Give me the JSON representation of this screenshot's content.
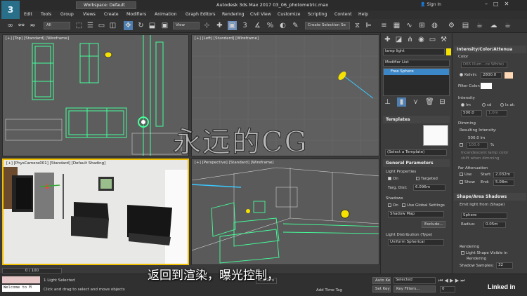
{
  "app": {
    "logo": "3",
    "title": "Autodesk 3ds Max 2017    03_06_photometric.max",
    "workspace": "Workspace: Default",
    "sign_in": "Sign In"
  },
  "menu": [
    "Edit",
    "Tools",
    "Group",
    "Views",
    "Create",
    "Modifiers",
    "Animation",
    "Graph Editors",
    "Rendering",
    "Civil View",
    "Customize",
    "Scripting",
    "Content",
    "Help"
  ],
  "toolbar": {
    "filter_dropdown": "All",
    "view_dropdown": "View",
    "selection_set": "Create Selection Se"
  },
  "viewports": {
    "top": "[+] [Top] [Standard] [Wireframe]",
    "left": "[+] [Left] [Standard] [Wireframe]",
    "camera": "[+] [PhysCamera001] [Standard] [Default Shading]",
    "perspective": "[+] [Perspective] [Standard] [Wireframe]"
  },
  "command_panel": {
    "object_name": "lamp light",
    "modifier_list": "Modifier List",
    "stack_item": "Free Sphere",
    "templates_header": "Templates",
    "templates_select": "(Select a Template)",
    "general_header": "General Parameters",
    "light_props": "Light Properties",
    "on": "On",
    "targeted": "Targeted",
    "targ_dist_label": "Targ. Dist:",
    "targ_dist": "6.096m",
    "shadows": "Shadows",
    "shadows_on": "On",
    "use_global": "Use Global Settings",
    "shadow_map": "Shadow Map",
    "exclude": "Exclude...",
    "light_dist_label": "Light Distribution (Type)",
    "light_dist": "Uniform Spherical"
  },
  "rollout": {
    "intensity_header": "Intensity/Color/Attenua",
    "color_label": "Color",
    "color_preset": "D65 Illum...ce White)",
    "kelvin_label": "Kelvin:",
    "kelvin": "2800.0",
    "filter_color": "Filter Color:",
    "intensity_label": "Intensity",
    "lm": "lm",
    "cd": "cd",
    "lx_at": "lx at:",
    "intensity_value": "500.0",
    "lx_dist": "1.0m",
    "dimming_label": "Dimming",
    "resulting": "Resulting Intensity:",
    "resulting_value": "500.0 lm",
    "dim_percent": "100.0",
    "percent_sign": "%",
    "incandescent": "Incandescent lamp color",
    "shift_dimming": "shift when dimming",
    "far_atten": "Far Attenuation",
    "use": "Use",
    "start_label": "Start:",
    "start": "2.032m",
    "show": "Show",
    "end_label": "End:",
    "end": "5.08m",
    "shape_header": "Shape/Area Shadows",
    "emit_label": "Emit light from (Shape)",
    "emit_shape": "Sphere",
    "radius_label": "Radius:",
    "radius": "0.05m",
    "rendering_label": "Rendering",
    "light_shape_1": "Light Shape Visible in",
    "light_shape_2": "Rendering",
    "shadow_samples_label": "Shadow Samples:",
    "shadow_samples": "32"
  },
  "status": {
    "frame_counter": "0 / 100",
    "script_listener": "Welcome to M",
    "selected": "1 Light Selected",
    "prompt": "Click and drag to select and move objects",
    "coord": "-6.064m",
    "add_time_tag": "Add Time Tag",
    "auto_key": "Auto Key",
    "selected_dropdown": "Selected",
    "set_key": "Set Key",
    "key_filters": "Key Filters...",
    "frame": "0",
    "linkedin": "Linked in"
  },
  "subtitle": "返回到渲染，曝光控制，",
  "watermark": "永远的CG",
  "colors": {
    "accent_yellow": "#f5e200",
    "selection_cyan": "#3cf5d0",
    "stack_blue": "#3c87c7"
  }
}
